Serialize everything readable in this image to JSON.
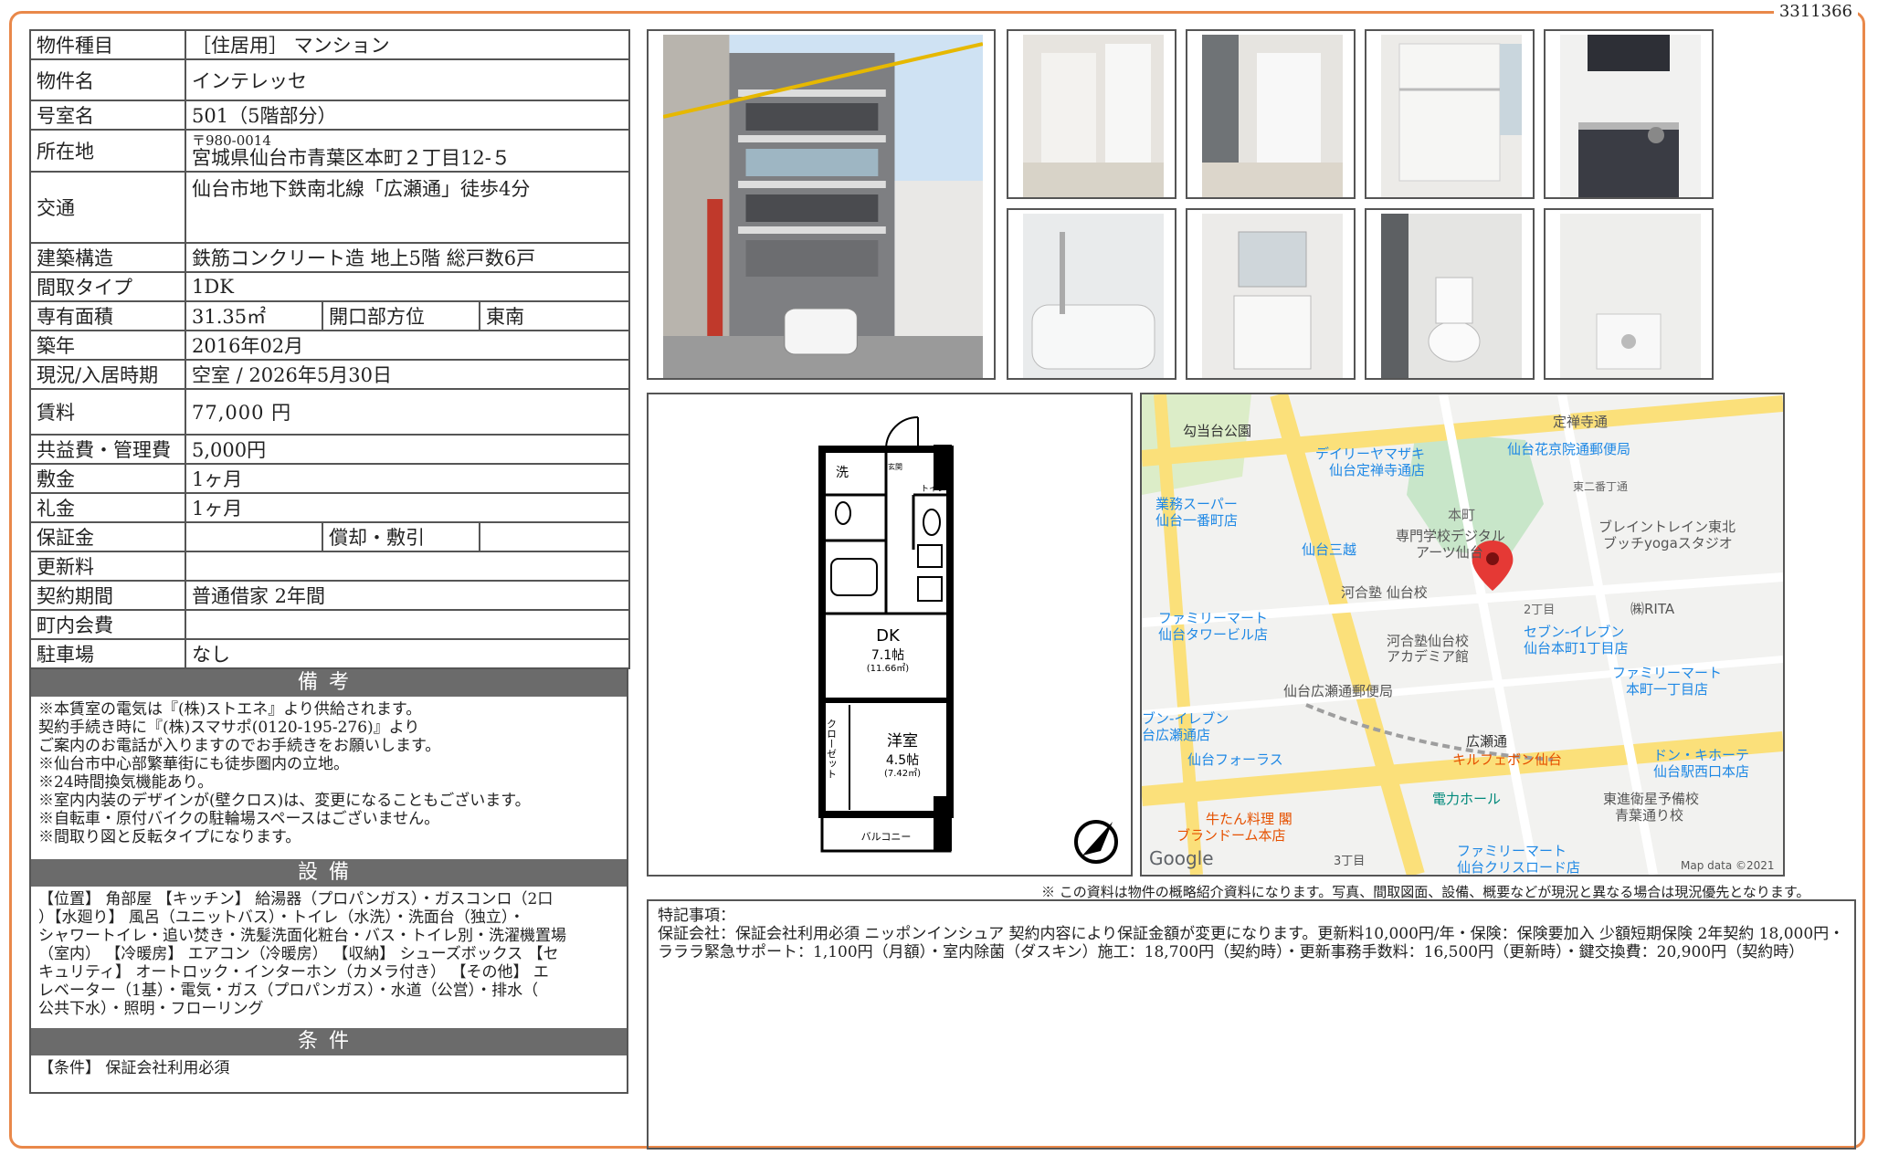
{
  "doc_id": "3311366",
  "spec": {
    "type_label": "物件種目",
    "type_value": "［住居用］ マンション",
    "name_label": "物件名",
    "name_value": "インテレッセ",
    "room_label": "号室名",
    "room_value": "501（5階部分）",
    "address_label": "所在地",
    "postal": "〒980-0014",
    "address_value": "宮城県仙台市青葉区本町２丁目12-５",
    "access_label": "交通",
    "access_value": "仙台市地下鉄南北線「広瀬通」徒歩4分",
    "structure_label": "建築構造",
    "structure_value": "鉄筋コンクリート造 地上5階 総戸数6戸",
    "layout_label": "間取タイプ",
    "layout_value": "1DK",
    "area_label": "専有面積",
    "area_value": "31.35㎡",
    "direction_label": "開口部方位",
    "direction_value": "東南",
    "built_label": "築年",
    "built_value": "2016年02月",
    "status_label": "現況/入居時期",
    "status_value": "空室 / 2026年5月30日",
    "rent_label": "賃料",
    "rent_value": "77,000 円",
    "fee_label": "共益費・管理費",
    "fee_value": "5,000円",
    "deposit_label": "敷金",
    "deposit_value": "1ヶ月",
    "key_money_label": "礼金",
    "key_money_value": "1ヶ月",
    "guarantee_label": "保証金",
    "guarantee_value": "",
    "amort_label": "償却・敷引",
    "amort_value": "",
    "renewal_label": "更新料",
    "renewal_value": "",
    "contract_label": "契約期間",
    "contract_value": "普通借家 2年間",
    "neighborhood_label": "町内会費",
    "neighborhood_value": "",
    "parking_label": "駐車場",
    "parking_value": "なし"
  },
  "sections": {
    "notes_title": "備考",
    "notes": [
      "※本賃室の電気は『(株)ストエネ』より供給されます。",
      "契約手続き時に『(株)スマサポ(0120-195-276)』より",
      "ご案内のお電話が入りますのでお手続きをお願いします。",
      "※仙台市中心部繁華街にも徒歩圏内の立地。",
      "※24時間換気機能あり。",
      "※室内内装のデザインが(壁クロス)は、変更になることもございます。",
      "※自転車・原付バイクの駐輪場スペースはございません。",
      "※間取り図と反転タイプになります。"
    ],
    "equip_title": "設備",
    "equipment": [
      "【位置】 角部屋 【キッチン】 給湯器（プロパンガス）・ガスコンロ（2口",
      "）【水廻り】 風呂（ユニットバス）・トイレ（水洗）・洗面台（独立）・",
      "シャワートイレ・追い焚き・洗髪洗面化粧台・バス・トイレ別・洗濯機置場",
      "（室内） 【冷暖房】 エアコン（冷暖房） 【収納】 シューズボックス 【セ",
      "キュリティ】 オートロック・インターホン（カメラ付き） 【その他】 エ",
      "レベーター（1基）・電気・ガス（プロパンガス）・水道（公営）・排水（",
      "公共下水）・照明・フローリング"
    ],
    "cond_title": "条件",
    "conditions": "【条件】 保証会社利用必須"
  },
  "floorplan": {
    "dk": "DK",
    "dk_size": "7.1帖",
    "dk_m2": "(11.66㎡)",
    "western": "洋室",
    "western_size": "4.5帖",
    "western_m2": "(7.42㎡)",
    "closet": "クローゼット",
    "balcony": "バルコニー",
    "wash": "洗",
    "toilet": "トイレ",
    "entry": "玄関"
  },
  "map": {
    "labels": [
      "定禅寺通",
      "勾当台公園",
      "デイリーヤマザキ",
      "仙台定禅寺通店",
      "仙台花京院通郵便局",
      "業務スーパー",
      "仙台一番町店",
      "仙台三越",
      "本町",
      "専門学校デジタル",
      "アーツ仙台",
      "東二番丁通",
      "ブレイントレイン東北",
      "ブッチyogaスタジオ",
      "河合塾 仙台校",
      "2丁目",
      "㈱RITA",
      "ファミリーマート",
      "仙台タワービル店",
      "河合塾仙台校",
      "アカデミア館",
      "セブン-イレブン",
      "仙台本町1丁目店",
      "ファミリーマート",
      "本町一丁目店",
      "仙台広瀬通郵便局",
      "ブン-イレブン",
      "台広瀬通店",
      "仙台フォーラス",
      "広瀬通",
      "キルフェボン仙台",
      "ドン・キホーテ",
      "仙台駅西口本店",
      "電力ホール",
      "東進衛星予備校",
      "青葉通り校",
      "牛たん料理 閣",
      "ブランドーム本店",
      "3丁目",
      "ファミリーマート",
      "仙台クリスロード店",
      "Google",
      "Map data ©2021"
    ]
  },
  "disclaimer": "※ この資料は物件の概略紹介資料になります。写真、間取図面、設備、概要などが現況と異なる場合は現況優先となります。",
  "remarks": {
    "title": "特記事項：",
    "body": "保証会社：保証会社利用必須 ニッポンインシュア 契約内容により保証金額が変更になります。更新料10,000円/年・保険：保険要加入 少額短期保険 2年契約 18,000円・ラララ緊急サポート：1,100円（月額）・室内除菌（ダスキン）施工：18,700円（契約時）・更新事務手数料：16,500円（更新時）・鍵交換費：20,900円（契約時）"
  },
  "colors": {
    "frame": "#e9884a",
    "section_bar": "#6b6b6b",
    "map_road": "#fbe07a",
    "map_park": "#c8e6c9",
    "pin": "#e53935"
  }
}
